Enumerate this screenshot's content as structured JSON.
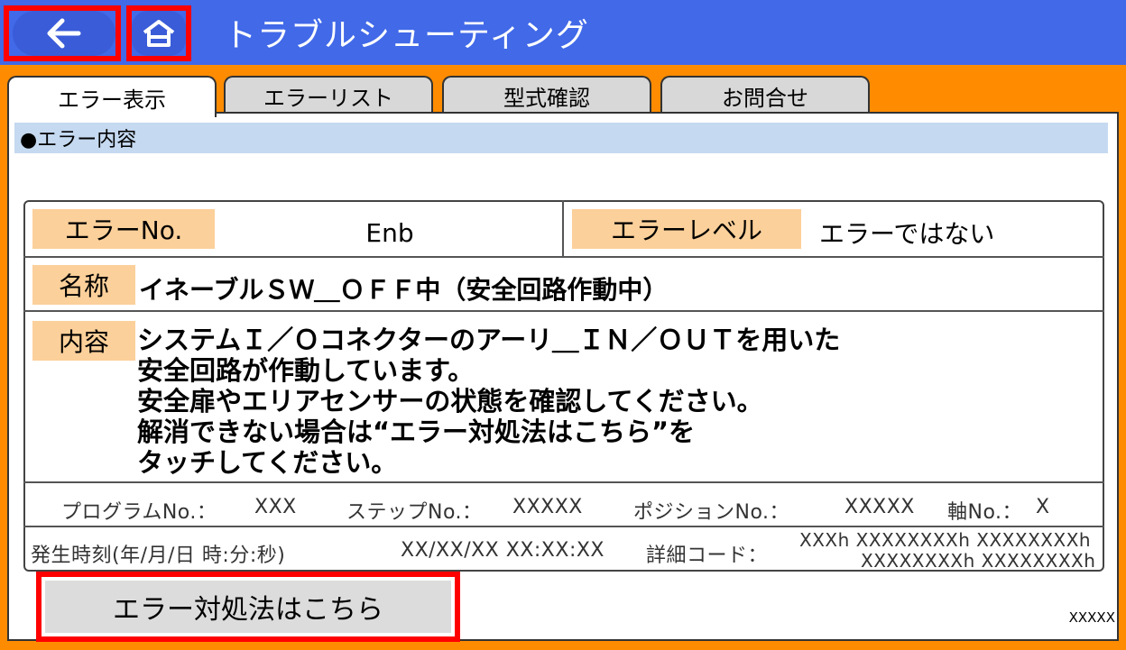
{
  "header": {
    "title": "トラブルシューティング"
  },
  "tabs": [
    {
      "label": "エラー表示",
      "active": true
    },
    {
      "label": "エラーリスト",
      "active": false
    },
    {
      "label": "型式確認",
      "active": false
    },
    {
      "label": "お問合せ",
      "active": false
    }
  ],
  "section": {
    "title": "●エラー内容"
  },
  "error": {
    "no_label": "エラーNo.",
    "no_value": "Enb",
    "level_label": "エラーレベル",
    "level_value": "エラーではない",
    "name_label": "名称",
    "name_value": "イネーブルＳＷ＿ＯＦＦ中（安全回路作動中）",
    "content_label": "内容",
    "content_lines": [
      "システムＩ／Ｏコネクターのアーリ＿ＩＮ／ＯＵＴを用いた",
      "安全回路が作動しています。",
      "安全扉やエリアセンサーの状態を確認してください。",
      "解消できない場合は“エラー対処法はこちら”を",
      "タッチしてください。"
    ]
  },
  "info": {
    "program_label": "プログラムNo.：",
    "program_value": "XXX",
    "step_label": "ステップNo.：",
    "step_value": "XXXXX",
    "position_label": "ポジションNo.：",
    "position_value": "XXXXX",
    "axis_label": "軸No.：",
    "axis_value": "X",
    "time_label": "発生時刻(年/月/日 時:分:秒)",
    "time_value": "XX/XX/XX XX:XX:XX",
    "detail_label": "詳細コード：",
    "detail_line1": "XXXh XXXXXXXXh XXXXXXXXh",
    "detail_line2": "XXXXXXXXh XXXXXXXXh"
  },
  "actions": {
    "solve_label": "エラー対処法はこちら"
  },
  "footer": {
    "version": "XXXXX"
  },
  "colors": {
    "header": "#4169e8",
    "accent": "#ff8c00",
    "label_bg": "#fcd09a",
    "section_bg": "#c5d9f0",
    "highlight": "#ff0000"
  }
}
